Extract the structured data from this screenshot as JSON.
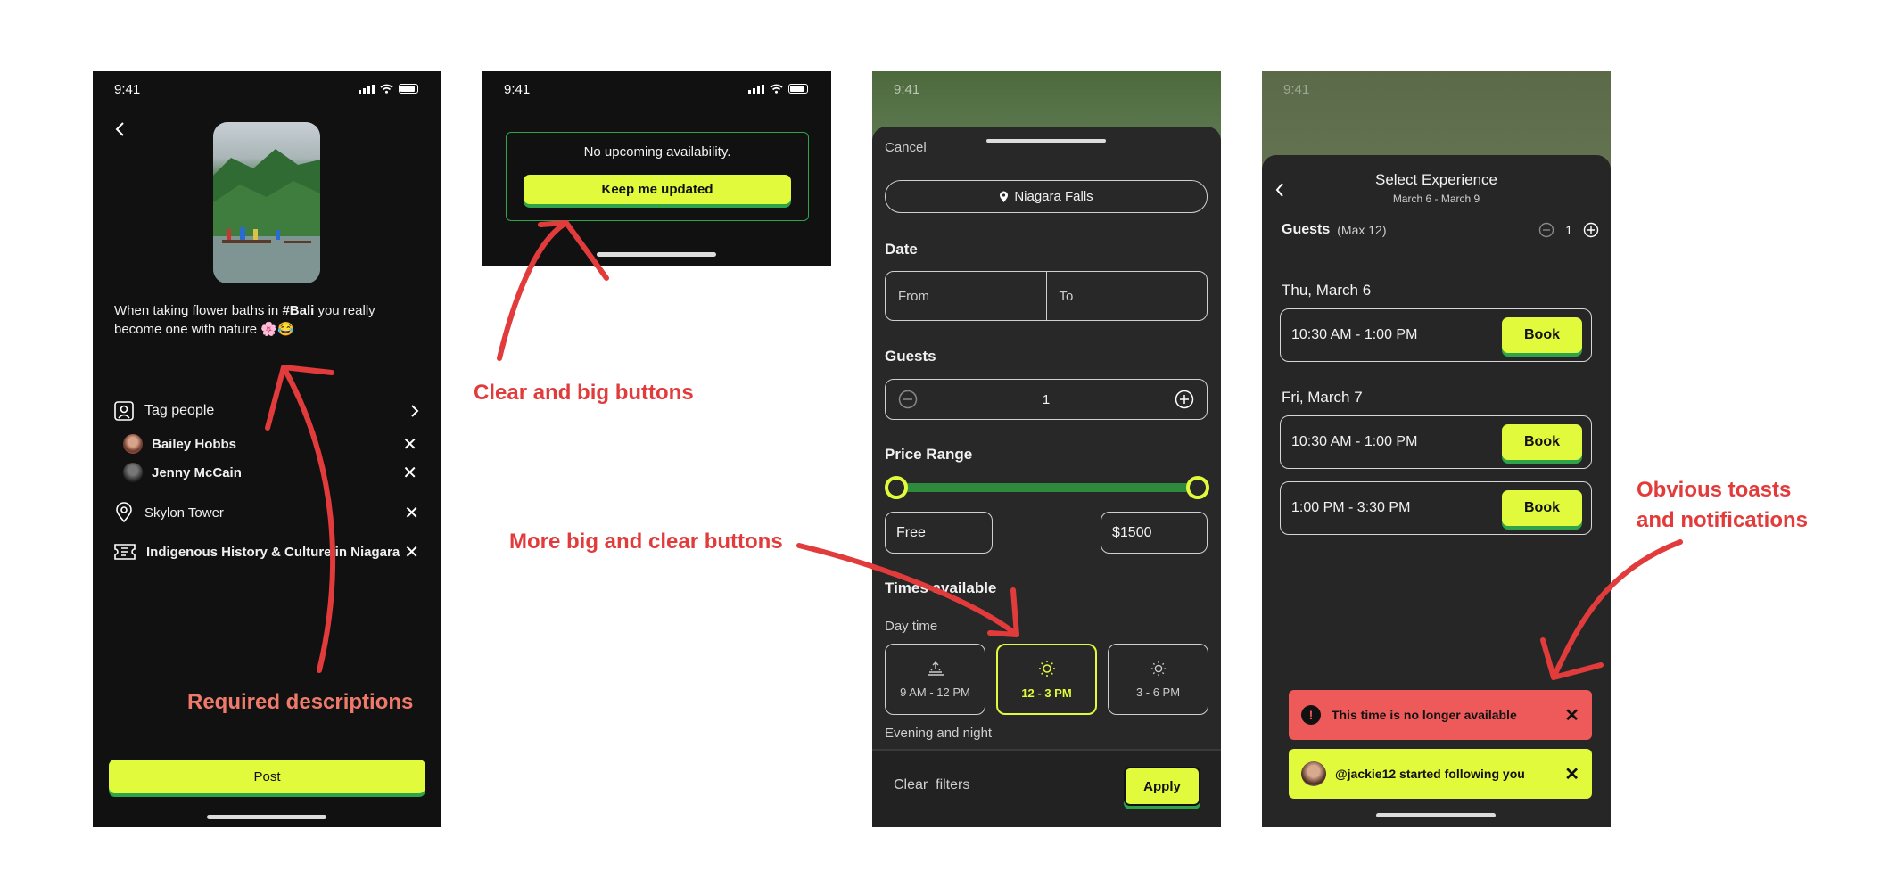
{
  "status_time": "9:41",
  "screen1": {
    "caption_pre": "When taking flower baths in ",
    "caption_tag": "#Bali",
    "caption_mid": " you really",
    "caption_line2": "become one with nature 🌸😂",
    "tag_people_label": "Tag people",
    "tagged": [
      {
        "name": "Bailey Hobbs"
      },
      {
        "name": "Jenny McCain"
      }
    ],
    "location": "Skylon Tower",
    "experience": "Indigenous History & Culture in Niagara",
    "post_label": "Post"
  },
  "screen2": {
    "message": "No upcoming availability.",
    "button_label": "Keep me updated"
  },
  "screen3": {
    "cancel_label": "Cancel",
    "location": "Niagara Falls",
    "date_label": "Date",
    "from_placeholder": "From",
    "to_placeholder": "To",
    "guests_label": "Guests",
    "guests_value": "1",
    "price_label": "Price Range",
    "price_min": "Free",
    "price_max": "$1500",
    "times_label": "Times available",
    "day_time_label": "Day time",
    "slots": [
      "9 AM - 12 PM",
      "12 - 3 PM",
      "3 - 6 PM"
    ],
    "evening_label": "Evening and night",
    "clear_label": "Clear  filters",
    "apply_label": "Apply"
  },
  "screen4": {
    "title": "Select Experience",
    "dates": "March 6 - March 9",
    "guests_label": "Guests",
    "guests_max": "(Max 12)",
    "guests_value": "1",
    "day1": "Thu, March 6",
    "day2": "Fri, March 7",
    "slot1": "10:30 AM - 1:00 PM",
    "slot2": "10:30 AM - 1:00 PM",
    "slot3": "1:00 PM - 3:30 PM",
    "book_label": "Book",
    "toast_error": "This time is no longer available",
    "toast_follow": "@jackie12 started following you"
  },
  "annotations": {
    "required": "Required descriptions",
    "clear_big": "Clear and big buttons",
    "more_big": "More big and clear buttons",
    "toasts_line1": "Obvious toasts",
    "toasts_line2": "and notifications"
  },
  "colors": {
    "accent": "#e2fa3c",
    "annotation": "#e23b3b",
    "error_toast": "#ee5a5a",
    "slider": "#2e8b3e"
  }
}
